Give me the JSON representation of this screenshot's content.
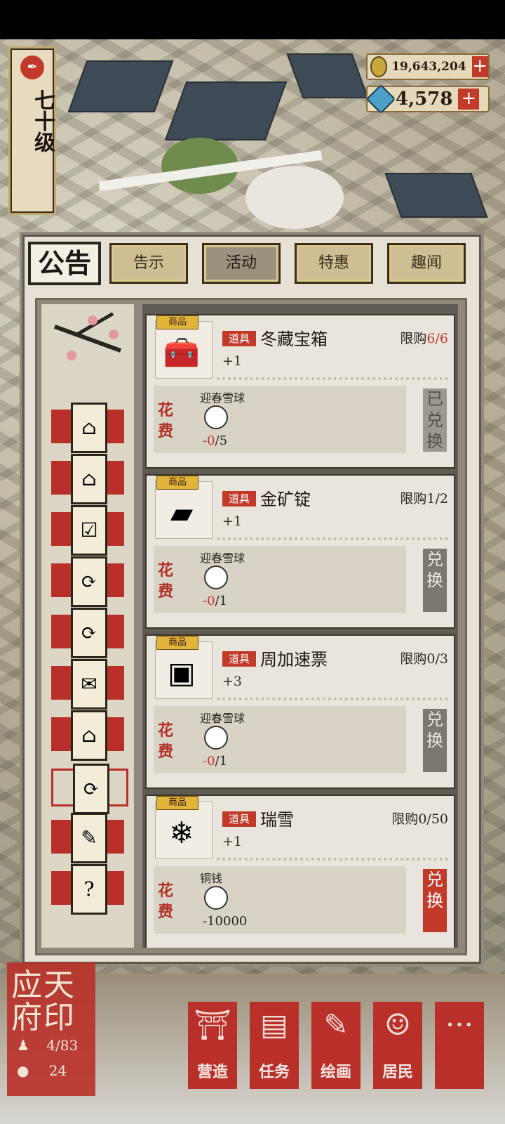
{
  "hud": {
    "level_text": "七十级",
    "level_icon": "brush-seal-icon",
    "coins": "19,643,204",
    "gems": "4,578",
    "plus": "+"
  },
  "panel": {
    "title": "公告",
    "tabs": [
      "告示",
      "活动",
      "特惠",
      "趣闻"
    ],
    "active_tab": "活动"
  },
  "side_icons": [
    "house-icon",
    "house-icon",
    "checklist-icon",
    "refresh-icon",
    "refresh-icon",
    "scroll-icon",
    "house-icon",
    "refresh-icon",
    "scroll-brush-icon",
    "mystery-bag-icon"
  ],
  "cards": [
    {
      "goods_tag": "商品",
      "item_tag": "道具",
      "name": "冬藏宝箱",
      "limit_label": "限购",
      "limit_done": "6/6",
      "limit_full": true,
      "qty": "+1",
      "cost_label": "花费",
      "cost_name": "迎春雪球",
      "cost_val_neg": "-0",
      "cost_val_rest": "/5",
      "button": "已兑换",
      "button_state": "done",
      "icon": "treasure-chest-icon"
    },
    {
      "goods_tag": "商品",
      "item_tag": "道具",
      "name": "金矿锭",
      "limit_label": "限购",
      "limit_done": "1/2",
      "limit_full": false,
      "qty": "+1",
      "cost_label": "花费",
      "cost_name": "迎春雪球",
      "cost_val_neg": "-0",
      "cost_val_rest": "/1",
      "button": "兑换",
      "button_state": "off",
      "icon": "gold-ingot-icon"
    },
    {
      "goods_tag": "商品",
      "item_tag": "道具",
      "name": "周加速票",
      "limit_label": "限购",
      "limit_done": "0/3",
      "limit_full": false,
      "qty": "+3",
      "cost_label": "花费",
      "cost_name": "迎春雪球",
      "cost_val_neg": "-0",
      "cost_val_rest": "/1",
      "button": "兑换",
      "button_state": "off",
      "icon": "speed-ticket-icon"
    },
    {
      "goods_tag": "商品",
      "item_tag": "道具",
      "name": "瑞雪",
      "limit_label": "限购",
      "limit_done": "0/50",
      "limit_full": false,
      "qty": "+1",
      "cost_label": "花费",
      "cost_name": "铜钱",
      "cost_val_neg": "",
      "cost_val_rest": "-10000",
      "button": "兑换",
      "button_state": "on",
      "icon": "snow-pile-icon"
    }
  ],
  "seal": {
    "title": "应天府印",
    "residents": "4/83",
    "coins": "24"
  },
  "nav": [
    {
      "label": "营造",
      "glyph": "⛩",
      "icon": "build-icon"
    },
    {
      "label": "任务",
      "glyph": "▤",
      "icon": "task-icon"
    },
    {
      "label": "绘画",
      "glyph": "✎",
      "icon": "paint-icon"
    },
    {
      "label": "居民",
      "glyph": "☺",
      "icon": "resident-icon"
    },
    {
      "label": "",
      "glyph": "···",
      "icon": "more-icon"
    }
  ]
}
